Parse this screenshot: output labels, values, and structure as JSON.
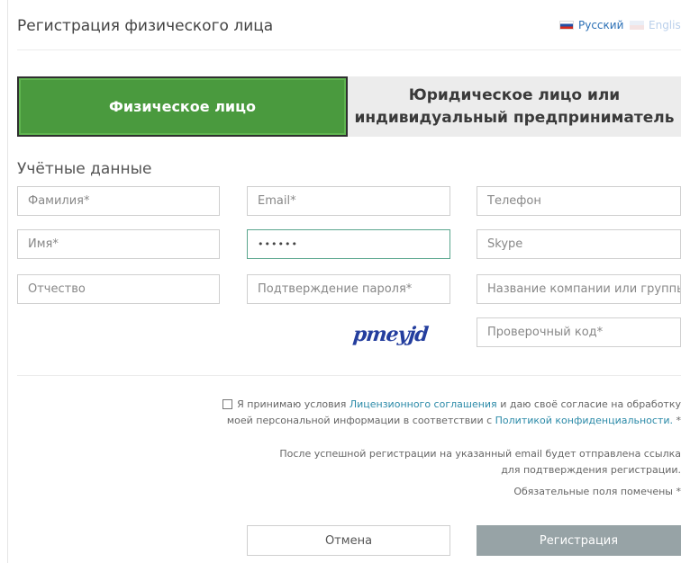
{
  "header": {
    "title": "Регистрация физического лица"
  },
  "languages": [
    {
      "label": "Русский",
      "active": true
    },
    {
      "label": "English",
      "active": false
    }
  ],
  "tabs": [
    {
      "label": "Физическое лицо",
      "active": true
    },
    {
      "label": "Юридическое лицо или индивидуальный предприниматель",
      "active": false
    }
  ],
  "section": {
    "title": "Учётные данные"
  },
  "fields": {
    "last_name": {
      "placeholder": "Фамилия*"
    },
    "email": {
      "placeholder": "Email*"
    },
    "phone": {
      "placeholder": "Телефон"
    },
    "first_name": {
      "placeholder": "Имя*"
    },
    "password": {
      "value": "••••••"
    },
    "skype": {
      "placeholder": "Skype"
    },
    "middle_name": {
      "placeholder": "Отчество"
    },
    "password_confirm": {
      "placeholder": "Подтверждение пароля*"
    },
    "company": {
      "placeholder": "Название компании или группы"
    },
    "captcha_code": {
      "placeholder": "Проверочный код*"
    }
  },
  "captcha": {
    "text": "pmeyjd"
  },
  "consent": {
    "prefix": "Я принимаю условия",
    "license_link": "Лицензионного соглашения",
    "middle": "и даю своё согласие на обработку моей персональной информации в соответствии с",
    "privacy_link": "Политикой конфиденциальности.",
    "required_mark": "*"
  },
  "notes": {
    "email_confirmation": "После успешной регистрации на указанный email будет отправлена ссылка для подтверждения регистрации.",
    "required_fields": "Обязательные поля помечены *"
  },
  "buttons": {
    "cancel": "Отмена",
    "register": "Регистрация"
  },
  "colors": {
    "active_tab": "#4a9a3e",
    "inactive_tab": "#ececec",
    "link": "#2b8aa8",
    "register_button": "#97a3a6",
    "focus_border": "#5aa68e",
    "captcha": "#243e9e"
  }
}
